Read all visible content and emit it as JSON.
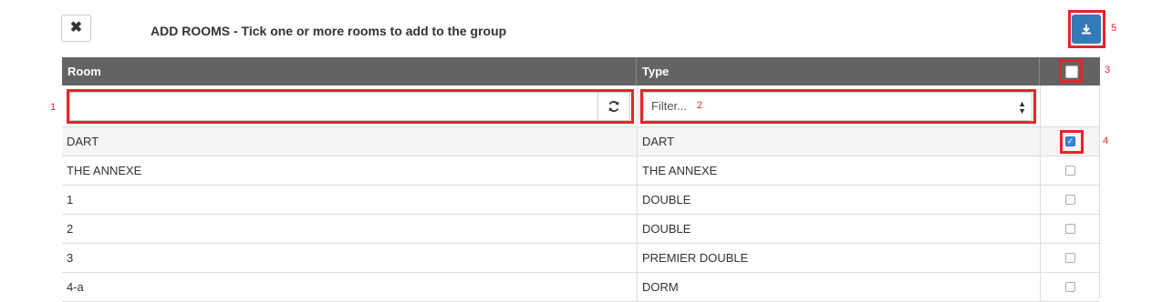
{
  "header": {
    "close_icon": "close-icon",
    "close_glyph": "✖",
    "title": "ADD ROOMS - Tick one or more rooms to add to the group",
    "download_icon": "download-icon"
  },
  "table": {
    "columns": [
      "Room",
      "Type",
      ""
    ],
    "search": {
      "value": "",
      "placeholder": ""
    },
    "type_filter": {
      "placeholder": "Filter..."
    },
    "rows": [
      {
        "room": "DART",
        "type": "DART",
        "checked": true
      },
      {
        "room": "THE ANNEXE",
        "type": "THE ANNEXE",
        "checked": false
      },
      {
        "room": "1",
        "type": "DOUBLE",
        "checked": false
      },
      {
        "room": "2",
        "type": "DOUBLE",
        "checked": false
      },
      {
        "room": "3",
        "type": "PREMIER DOUBLE",
        "checked": false
      },
      {
        "room": "4-a",
        "type": "DORM",
        "checked": false
      }
    ]
  },
  "annotations": [
    "1",
    "2",
    "3",
    "4",
    "5"
  ],
  "colors": {
    "accent": "#337ab7",
    "highlight": "#e8232b",
    "header_bg": "#636363"
  }
}
